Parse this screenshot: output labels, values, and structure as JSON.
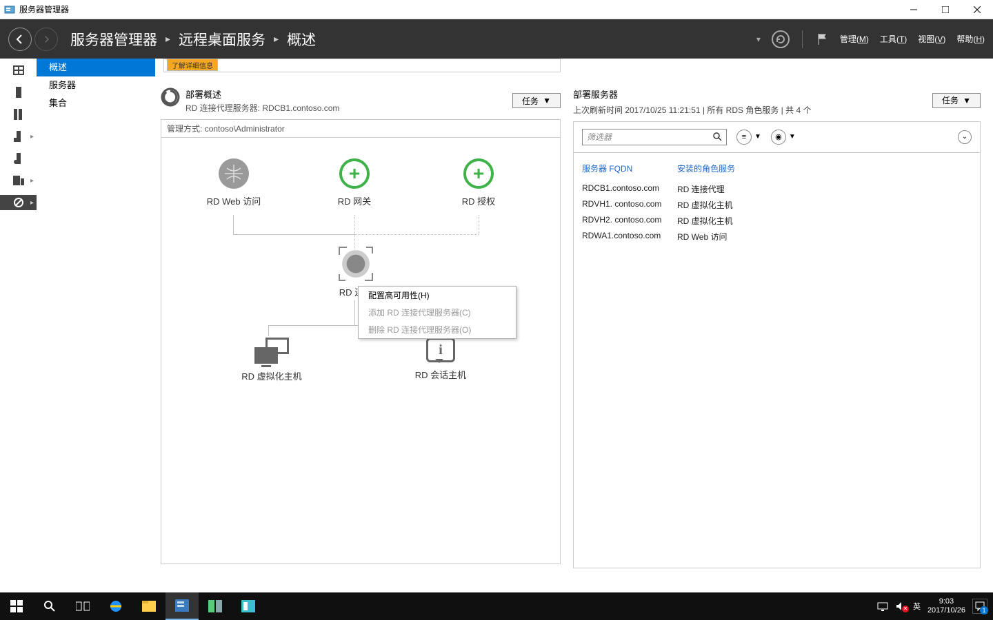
{
  "window": {
    "title": "服务器管理器"
  },
  "breadcrumb": {
    "root": "服务器管理器",
    "level1": "远程桌面服务",
    "level2": "概述"
  },
  "topmenu": {
    "manage": "管理",
    "manage_key": "M",
    "tools": "工具",
    "tools_key": "T",
    "view": "视图",
    "view_key": "V",
    "help": "帮助",
    "help_key": "H"
  },
  "nav": {
    "overview": "概述",
    "servers": "服务器",
    "collections": "集合"
  },
  "infobar": {
    "text": "了解详细信息"
  },
  "deploy_overview": {
    "title": "部署概述",
    "subtitle_prefix": "RD 连接代理服务器:",
    "subtitle_server": "RDCB1.contoso.com",
    "manage_prefix": "管理方式:",
    "manage_user": "contoso\\Administrator",
    "tasks_label": "任务",
    "nodes": {
      "web": "RD Web 访问",
      "gateway": "RD 网关",
      "license": "RD 授权",
      "broker": "RD 连接",
      "virthost": "RD 虚拟化主机",
      "sessionhost": "RD 会话主机"
    }
  },
  "context_menu": {
    "item1": "配置高可用性(H)",
    "item2": "添加 RD 连接代理服务器(C)",
    "item3": "删除 RD 连接代理服务器(O)"
  },
  "deploy_servers": {
    "title": "部署服务器",
    "meta": "上次刷新时间 2017/10/25 11:21:51 | 所有 RDS 角色服务  | 共 4 个",
    "tasks_label": "任务",
    "filter_placeholder": "筛选器",
    "columns": {
      "fqdn": "服务器 FQDN",
      "role": "安装的角色服务"
    },
    "rows": [
      {
        "fqdn": "RDCB1.contoso.com",
        "role": "RD 连接代理"
      },
      {
        "fqdn": "RDVH1. contoso.com",
        "role": "RD 虚拟化主机"
      },
      {
        "fqdn": "RDVH2. contoso.com",
        "role": "RD 虚拟化主机"
      },
      {
        "fqdn": "RDWA1.contoso.com",
        "role": "RD Web 访问"
      }
    ]
  },
  "taskbar": {
    "ime": "英",
    "time": "9:03",
    "date": "2017/10/26",
    "notif_count": "1"
  }
}
